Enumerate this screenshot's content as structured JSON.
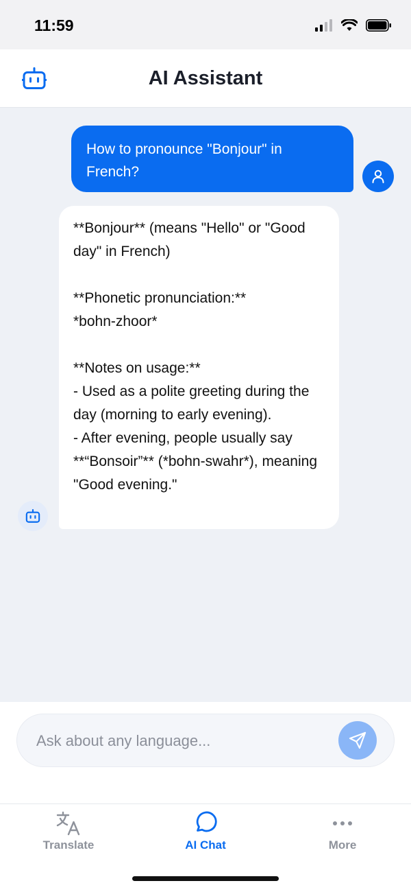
{
  "status": {
    "time": "11:59"
  },
  "header": {
    "title": "AI Assistant"
  },
  "messages": {
    "user_text": "How to pronounce \"Bonjour\" in French?",
    "assistant_text": "**Bonjour** (means \"Hello\" or \"Good day\" in French)\n\n**Phonetic pronunciation:**\n*bohn-zhoor*\n\n**Notes on usage:**\n- Used as a polite greeting during the day (morning to early evening).\n- After evening, people usually say **“Bonsoir”** (*bohn-swahr*), meaning \"Good evening.\""
  },
  "input": {
    "placeholder": "Ask about any language..."
  },
  "tabs": {
    "translate": "Translate",
    "ai_chat": "AI Chat",
    "more": "More"
  },
  "colors": {
    "accent": "#0a6cf0",
    "send_button_disabled": "#8ab6f7",
    "tab_inactive": "#8e929b",
    "background": "#eef1f6"
  },
  "icons": {
    "header": "robot-icon",
    "user_avatar": "person-icon",
    "bot_avatar": "robot-icon",
    "send": "paper-plane-icon",
    "translate_tab": "translate-icon",
    "chat_tab": "chat-bubble-icon",
    "more_tab": "ellipsis-icon"
  }
}
